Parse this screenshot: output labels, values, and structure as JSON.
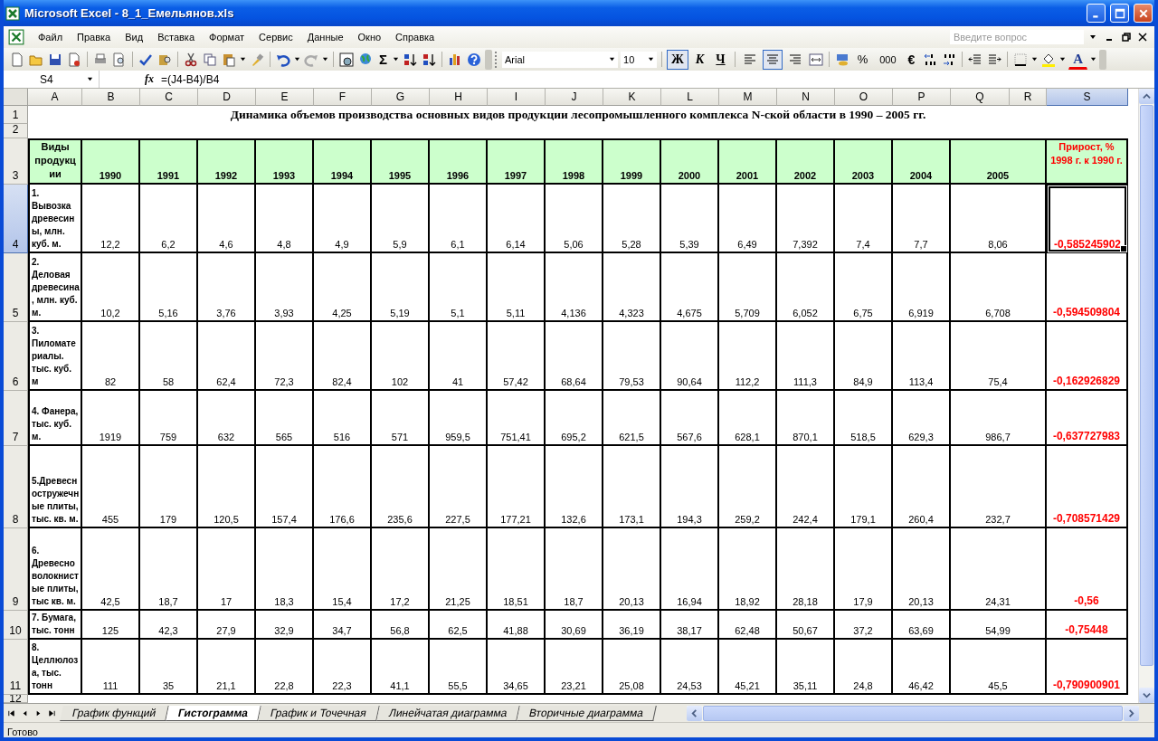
{
  "window": {
    "title": "Microsoft Excel - 8_1_Емельянов.xls"
  },
  "menu": [
    "Файл",
    "Правка",
    "Вид",
    "Вставка",
    "Формат",
    "Сервис",
    "Данные",
    "Окно",
    "Справка"
  ],
  "help_search": {
    "placeholder": "Введите вопрос"
  },
  "toolbar": {
    "autosum_label": "Σ",
    "font": "Arial",
    "size": "10",
    "format_buttons": [
      {
        "label": "Ж",
        "selected": true
      },
      {
        "label": "К",
        "selected": false
      },
      {
        "label": "Ч",
        "selected": false
      }
    ],
    "align_buttons": [
      {
        "selected": false
      },
      {
        "selected": true
      },
      {
        "selected": false
      }
    ],
    "number_buttons": [
      "%",
      "000",
      "€"
    ],
    "font_color_label": "A"
  },
  "formula_bar": {
    "name_box": "S4",
    "function_label": "fx",
    "formula": "=(J4-B4)/B4"
  },
  "columns": [
    {
      "label": "A",
      "selected": false
    },
    {
      "label": "B",
      "selected": false
    },
    {
      "label": "C",
      "selected": false
    },
    {
      "label": "D",
      "selected": false
    },
    {
      "label": "E",
      "selected": false
    },
    {
      "label": "F",
      "selected": false
    },
    {
      "label": "G",
      "selected": false
    },
    {
      "label": "H",
      "selected": false
    },
    {
      "label": "I",
      "selected": false
    },
    {
      "label": "J",
      "selected": false
    },
    {
      "label": "K",
      "selected": false
    },
    {
      "label": "L",
      "selected": false
    },
    {
      "label": "M",
      "selected": false
    },
    {
      "label": "N",
      "selected": false
    },
    {
      "label": "O",
      "selected": false
    },
    {
      "label": "P",
      "selected": false
    },
    {
      "label": "Q",
      "selected": false
    },
    {
      "label": "R",
      "selected": false
    },
    {
      "label": "S",
      "selected": true
    }
  ],
  "row_numbers": [
    {
      "label": "1",
      "selected": false
    },
    {
      "label": "2",
      "selected": false
    },
    {
      "label": "3",
      "selected": false
    },
    {
      "label": "4",
      "selected": true
    },
    {
      "label": "5",
      "selected": false
    },
    {
      "label": "6",
      "selected": false
    },
    {
      "label": "7",
      "selected": false
    },
    {
      "label": "8",
      "selected": false
    },
    {
      "label": "9",
      "selected": false
    },
    {
      "label": "10",
      "selected": false
    },
    {
      "label": "11",
      "selected": false
    },
    {
      "label": "12",
      "selected": false
    }
  ],
  "sheet_title": "Динамика объемов производства основных видов продукции лесопромышленного комплекса N-ской области в 1990 – 2005 гг.",
  "table": {
    "first_header": "Виды продукции",
    "years": [
      "1990",
      "1991",
      "1992",
      "1993",
      "1994",
      "1995",
      "1996",
      "1997",
      "1998",
      "1999",
      "2000",
      "2001",
      "2002",
      "2003",
      "2004",
      "2005"
    ],
    "growth_header": "Прирост, % 1998 г.  к 1990 г.",
    "rows": [
      {
        "label": "1. Вывозка древесины, млн. куб. м.",
        "values": [
          "12,2",
          "6,2",
          "4,6",
          "4,8",
          "4,9",
          "5,9",
          "6,1",
          "6,14",
          "5,06",
          "5,28",
          "5,39",
          "6,49",
          "7,392",
          "7,4",
          "7,7",
          "8,06"
        ],
        "growth": "-0,585245902"
      },
      {
        "label": "2. Деловая древесина, млн. куб. м.",
        "values": [
          "10,2",
          "5,16",
          "3,76",
          "3,93",
          "4,25",
          "5,19",
          "5,1",
          "5,11",
          "4,136",
          "4,323",
          "4,675",
          "5,709",
          "6,052",
          "6,75",
          "6,919",
          "6,708"
        ],
        "growth": "-0,594509804"
      },
      {
        "label": "3. Пиломатериалы. тыс. куб. м",
        "values": [
          "82",
          "58",
          "62,4",
          "72,3",
          "82,4",
          "102",
          "41",
          "57,42",
          "68,64",
          "79,53",
          "90,64",
          "112,2",
          "111,3",
          "84,9",
          "113,4",
          "75,4"
        ],
        "growth": "-0,162926829"
      },
      {
        "label": "4. Фанера, тыс. куб. м.",
        "values": [
          "1919",
          "759",
          "632",
          "565",
          "516",
          "571",
          "959,5",
          "751,41",
          "695,2",
          "621,5",
          "567,6",
          "628,1",
          "870,1",
          "518,5",
          "629,3",
          "986,7"
        ],
        "growth": "-0,637727983"
      },
      {
        "label": "5.Древесностружечные плиты, тыс. кв. м.",
        "values": [
          "455",
          "179",
          "120,5",
          "157,4",
          "176,6",
          "235,6",
          "227,5",
          "177,21",
          "132,6",
          "173,1",
          "194,3",
          "259,2",
          "242,4",
          "179,1",
          "260,4",
          "232,7"
        ],
        "growth": "-0,708571429"
      },
      {
        "label": "6. Древесноволокнистые плиты, тыс кв. м.",
        "values": [
          "42,5",
          "18,7",
          "17",
          "18,3",
          "15,4",
          "17,2",
          "21,25",
          "18,51",
          "18,7",
          "20,13",
          "16,94",
          "18,92",
          "28,18",
          "17,9",
          "20,13",
          "24,31"
        ],
        "growth": "-0,56"
      },
      {
        "label": "7. Бумага, тыс. тонн",
        "values": [
          "125",
          "42,3",
          "27,9",
          "32,9",
          "34,7",
          "56,8",
          "62,5",
          "41,88",
          "30,69",
          "36,19",
          "38,17",
          "62,48",
          "50,67",
          "37,2",
          "63,69",
          "54,99"
        ],
        "growth": "-0,75448"
      },
      {
        "label": "8. Целлюлоза, тыс. тонн",
        "values": [
          "111",
          "35",
          "21,1",
          "22,8",
          "22,3",
          "41,1",
          "55,5",
          "34,65",
          "23,21",
          "25,08",
          "24,53",
          "45,21",
          "35,11",
          "24,8",
          "46,42",
          "45,5"
        ],
        "growth": "-0,790900901"
      }
    ]
  },
  "sheet_tabs": [
    {
      "label": "График функций",
      "selected": false
    },
    {
      "label": "Гистограмма",
      "selected": true
    },
    {
      "label": "График и Точечная",
      "selected": false
    },
    {
      "label": "Линейчатая диаграмма",
      "selected": false
    },
    {
      "label": "Вторичные диаграмма",
      "selected": false
    }
  ],
  "status_bar": "Готово"
}
